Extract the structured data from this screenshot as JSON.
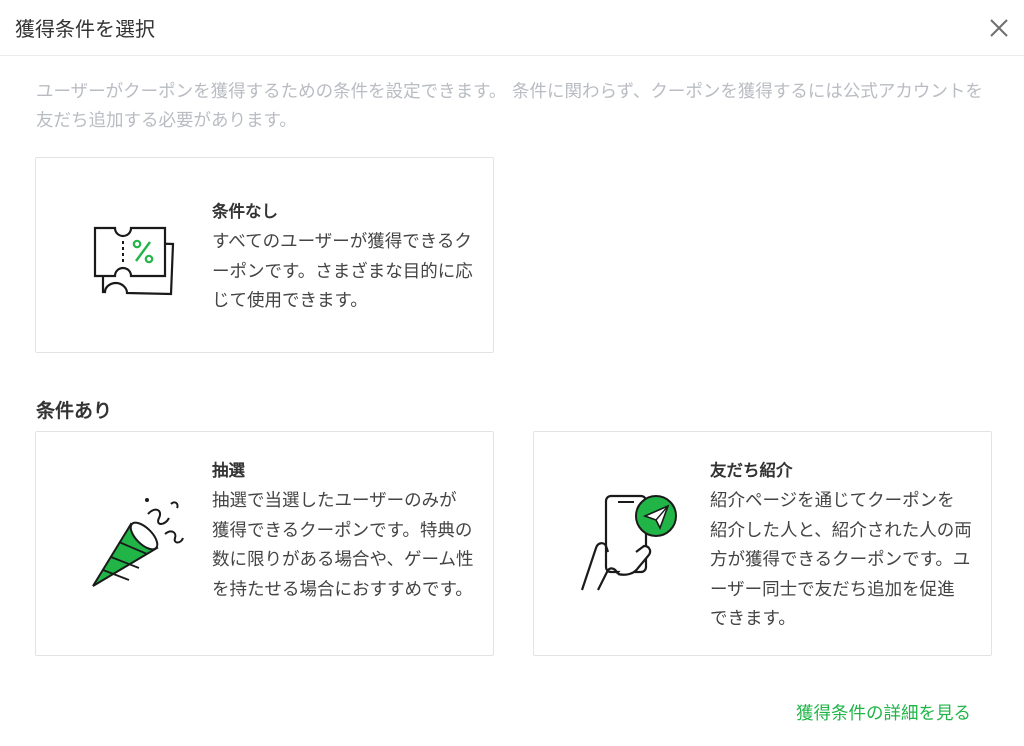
{
  "dialog": {
    "title": "獲得条件を選択",
    "close_icon": "close-icon"
  },
  "description": "ユーザーがクーポンを獲得するための条件を設定できます。 条件に関わらず、クーポンを獲得するには公式アカウントを友だち追加する必要があります。",
  "options": {
    "none": {
      "title": "条件なし",
      "description": "すべてのユーザーが獲得できるクーポンです。さまざまな目的に応じて使用できます。",
      "icon": "coupon-ticket-icon"
    },
    "section_title": "条件あり",
    "lottery": {
      "title": "抽選",
      "description": "抽選で当選したユーザーのみが獲得できるクーポンです。特典の数に限りがある場合や、ゲーム性を持たせる場合におすすめです。",
      "icon": "party-popper-icon"
    },
    "referral": {
      "title": "友だち紹介",
      "description": "紹介ページを通じてクーポンを紹介した人と、紹介された人の両方が獲得できるクーポンです。ユーザー同士で友だち追加を促進できます。",
      "icon": "phone-send-icon"
    }
  },
  "details_link": "獲得条件の詳細を見る",
  "colors": {
    "accent": "#21b548",
    "muted_text": "#b9bcc2",
    "border": "#e3e3e3"
  }
}
